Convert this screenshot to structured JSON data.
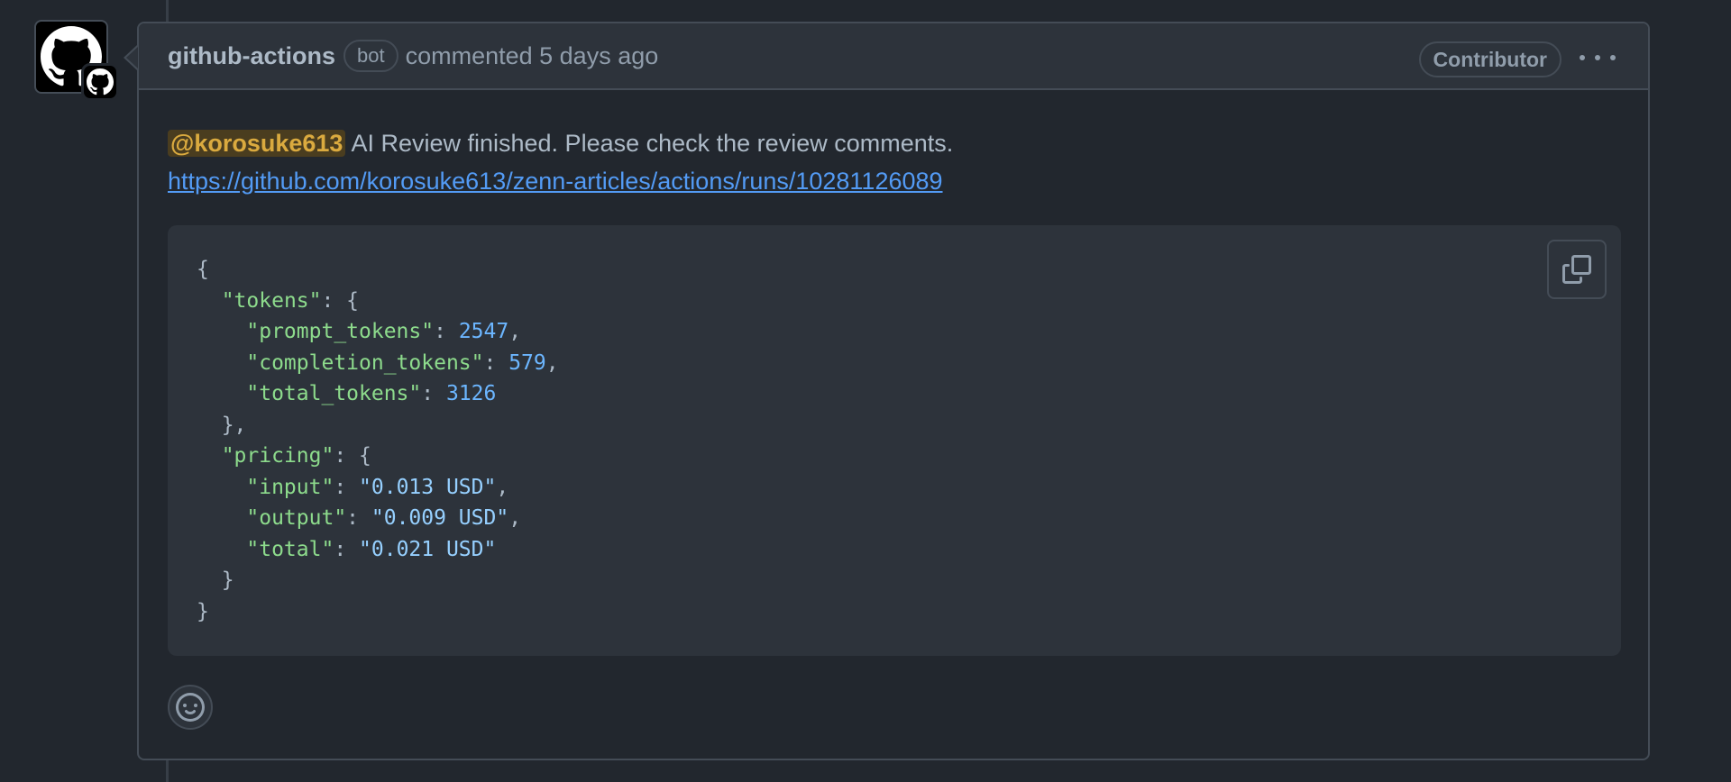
{
  "comment": {
    "author": "github-actions",
    "author_badge": "bot",
    "timestamp": "commented 5 days ago",
    "role_badge": "Contributor",
    "avatar_icon": "github-mark-icon",
    "mention": "@korosuke613",
    "message": " AI Review finished. Please check the review comments.",
    "link": "https://github.com/korosuke613/zenn-articles/actions/runs/10281126089"
  },
  "code": {
    "open_brace": "{",
    "tokens_key": "\"tokens\"",
    "prompt_tokens_key": "\"prompt_tokens\"",
    "prompt_tokens_value": "2547",
    "completion_tokens_key": "\"completion_tokens\"",
    "completion_tokens_value": "579",
    "total_tokens_key": "\"total_tokens\"",
    "total_tokens_value": "3126",
    "pricing_key": "\"pricing\"",
    "input_key": "\"input\"",
    "input_value": "\"0.013 USD\"",
    "output_key": "\"output\"",
    "output_value": "\"0.009 USD\"",
    "total_key": "\"total\"",
    "total_value": "\"0.021 USD\"",
    "close_brace": "}"
  },
  "icons": {
    "copy": "copy-icon",
    "reaction": "smiley-icon",
    "menu": "kebab-horizontal-icon"
  },
  "colors": {
    "background": "#22272e",
    "header": "#2d333b",
    "link": "#539bf5",
    "mention": "#daaa3f",
    "json_key": "#8ddb8c",
    "json_string": "#96d0ff"
  }
}
